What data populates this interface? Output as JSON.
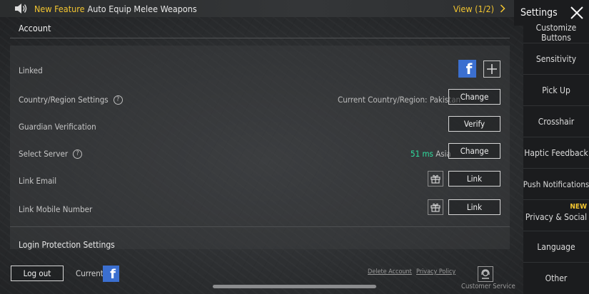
{
  "notice": {
    "feature_tag": "New Feature",
    "message": "Auto Equip Melee Weapons",
    "view_label": "View (1/2)"
  },
  "account": {
    "section_title": "Account",
    "rows": {
      "linked": {
        "label": "Linked"
      },
      "country": {
        "label": "Country/Region Settings",
        "info": "Current Country/Region: Pakistan",
        "button": "Change"
      },
      "guardian": {
        "label": "Guardian Verification",
        "button": "Verify"
      },
      "server": {
        "label": "Select Server",
        "ping": "51 ms",
        "region": "Asia",
        "button": "Change"
      },
      "email": {
        "label": "Link Email",
        "button": "Link"
      },
      "mobile": {
        "label": "Link Mobile Number",
        "button": "Link"
      }
    },
    "login_protection": "Login Protection Settings"
  },
  "footer": {
    "logout": "Log out",
    "current": "Current",
    "delete_account": "Delete Account",
    "privacy_policy": "Privacy Policy",
    "customer_service": "Customer Service"
  },
  "sidebar": {
    "title": "Settings",
    "items": [
      {
        "label": "Customize Buttons"
      },
      {
        "label": "Sensitivity"
      },
      {
        "label": "Pick Up"
      },
      {
        "label": "Crosshair"
      },
      {
        "label": "Haptic Feedback"
      },
      {
        "label": "Push Notifications"
      },
      {
        "label": "Privacy & Social",
        "badge": "NEW"
      },
      {
        "label": "Language"
      },
      {
        "label": "Other"
      }
    ]
  },
  "colors": {
    "accent_yellow": "#f2c530",
    "ping_green": "#2ee0a0",
    "facebook_blue": "#3b6fd0"
  }
}
